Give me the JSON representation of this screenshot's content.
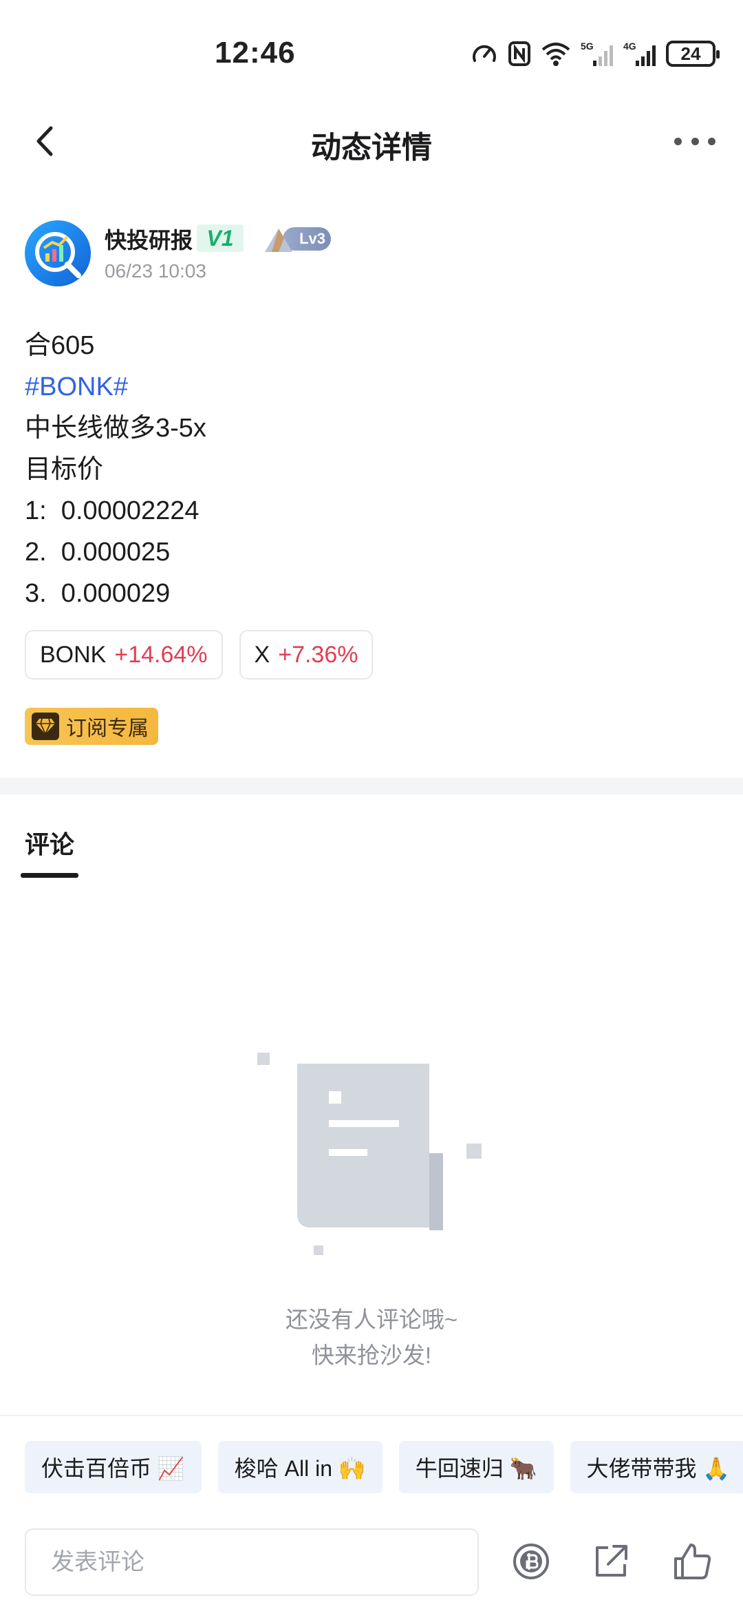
{
  "status_bar": {
    "time": "12:46",
    "battery": "24",
    "network_1": "5G",
    "network_2": "4G"
  },
  "nav": {
    "title": "动态详情"
  },
  "author": {
    "name": "快投研报",
    "vip_badge": "V1",
    "level_badge": "Lv3",
    "time": "06/23 10:03"
  },
  "post": {
    "lines": [
      "合605",
      "#BONK#",
      "中长线做多3-5x",
      "目标价",
      "1:  0.00002224",
      "2.  0.000025",
      "3.  0.000029"
    ]
  },
  "tickers": [
    {
      "symbol": "BONK",
      "change": "+14.64%"
    },
    {
      "symbol": "X",
      "change": "+7.36%"
    }
  ],
  "subscription_badge": "订阅专属",
  "comments": {
    "tab_label": "评论",
    "empty_line_1": "还没有人评论哦~",
    "empty_line_2": "快来抢沙发!"
  },
  "quick_replies": [
    "伏击百倍币 📈",
    "梭哈 All in 🙌",
    "牛回速归 🐂",
    "大佬带带我 🙏"
  ],
  "comment_input": {
    "placeholder": "发表评论"
  },
  "colors": {
    "accent_blue": "#2f62e6",
    "positive_red": "#e23d52",
    "vip_green": "#16b06a",
    "badge_gold": "#f4b83e"
  }
}
